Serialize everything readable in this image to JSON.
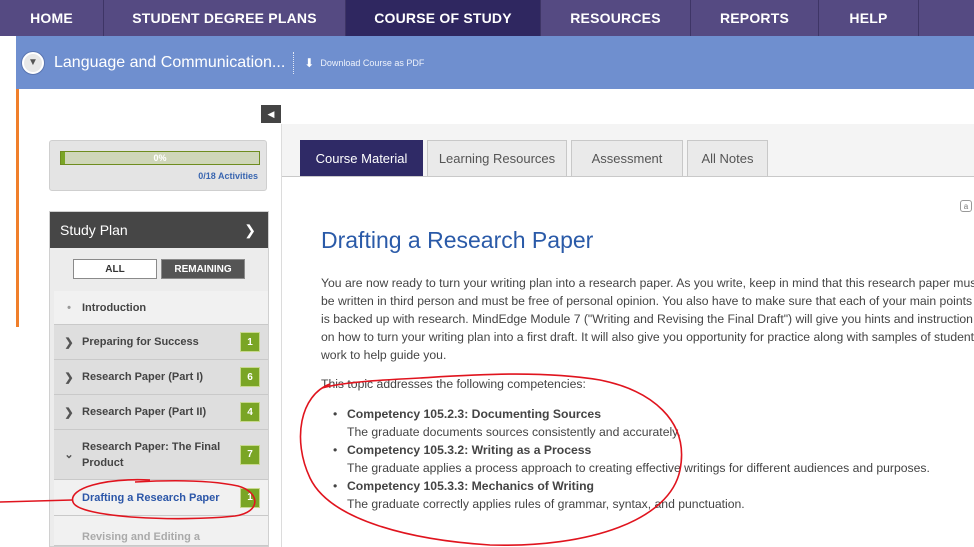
{
  "nav": {
    "items": [
      {
        "label": "HOME",
        "width": 104
      },
      {
        "label": "STUDENT DEGREE PLANS",
        "width": 242
      },
      {
        "label": "COURSE OF STUDY",
        "width": 195,
        "active": true
      },
      {
        "label": "RESOURCES",
        "width": 150
      },
      {
        "label": "REPORTS",
        "width": 128
      },
      {
        "label": "HELP",
        "width": 100
      },
      {
        "label": "",
        "width": 55
      }
    ]
  },
  "course": {
    "title": "Language and Communication...",
    "download_label": "Download Course as PDF"
  },
  "progress": {
    "percent_label": "0%",
    "fraction": 0.02,
    "activities": "0/18 Activities"
  },
  "study_plan": {
    "title": "Study Plan",
    "filter_all": "ALL",
    "filter_remaining": "REMAINING",
    "items": [
      {
        "label": "Introduction",
        "bullet": "dot",
        "badge": ""
      },
      {
        "label": "Preparing for Success",
        "bullet": "right",
        "badge": "1"
      },
      {
        "label": "Research Paper (Part I)",
        "bullet": "right",
        "badge": "6"
      },
      {
        "label": "Research Paper (Part II)",
        "bullet": "right",
        "badge": "4"
      },
      {
        "label": "Research Paper: The Final Product",
        "bullet": "down",
        "badge": "7"
      },
      {
        "label": "Drafting a Research Paper",
        "bullet": "none",
        "badge": "1"
      },
      {
        "label": "Revising and Editing a",
        "bullet": "none",
        "badge": ""
      }
    ]
  },
  "tabs": [
    "Course Material",
    "Learning Resources",
    "Assessment",
    "All Notes"
  ],
  "content": {
    "title": "Drafting a Research Paper",
    "intro": "You are now ready to turn your writing plan into a research paper. As you write, keep in mind that this research paper must be written in third person and must be free of personal opinion. You also have to make sure that each of your main points is backed up with research. MindEdge Module 7 (\"Writing and Revising the Final Draft\") will give you hints and instruction on how to turn your writing plan into a first draft. It will also give you opportunity for practice along with samples of student work to help guide you.",
    "topic_line": "This topic addresses the following competencies:",
    "competencies": [
      {
        "title": "Competency 105.2.3: Documenting Sources",
        "desc": "The graduate documents sources consistently and accurately."
      },
      {
        "title": "Competency 105.3.2: Writing as a Process",
        "desc": "The graduate applies a process approach to creating effective writings for different audiences and purposes."
      },
      {
        "title": "Competency 105.3.3: Mechanics of Writing",
        "desc": "The graduate correctly applies rules of grammar, syntax, and punctuation."
      }
    ]
  },
  "colors": {
    "nav": "#554a82",
    "nav_active": "#2f2760",
    "course_bar": "#6f8fcf",
    "accent_orange": "#f07f2a",
    "badge_green": "#7aa525",
    "title_blue": "#2a5aa8",
    "annotation_red": "#e0141e"
  },
  "icons": {
    "collapse": "chevron-down-circle-icon",
    "download": "download-icon",
    "sidebar_toggle": "caret-left-icon",
    "study_plan_arrow": "chevron-right-icon"
  }
}
